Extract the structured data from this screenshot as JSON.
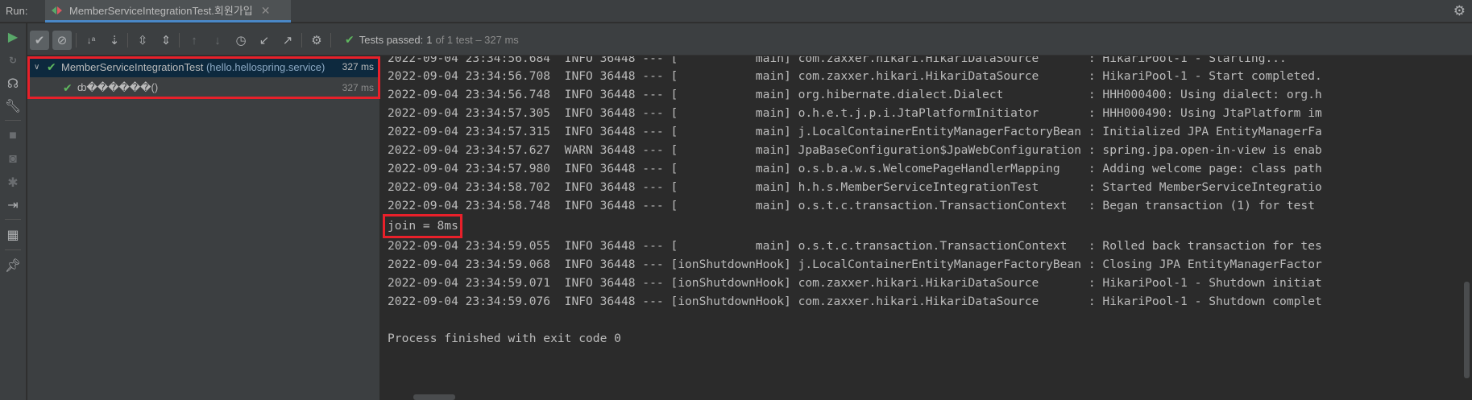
{
  "run": {
    "label": "Run:",
    "tab_title": "MemberServiceIntegrationTest.회원가입",
    "tab_close": "✕"
  },
  "status": {
    "label": "Tests passed:",
    "passed": "1",
    "rest": "of 1 test – 327 ms"
  },
  "tree": {
    "root": {
      "name": "MemberServiceIntegrationTest",
      "package": "(hello.hellospring.service)",
      "time": "327 ms"
    },
    "child": {
      "name": "ȸ������()",
      "time": "327 ms"
    }
  },
  "console": {
    "partial_line": "2022-09-04 23:34:56.684  INFO 36448 --- [           main] com.zaxxer.hikari.HikariDataSource       : HikariPool-1 - Starting...",
    "lines_before": [
      "2022-09-04 23:34:56.708  INFO 36448 --- [           main] com.zaxxer.hikari.HikariDataSource       : HikariPool-1 - Start completed.",
      "2022-09-04 23:34:56.748  INFO 36448 --- [           main] org.hibernate.dialect.Dialect            : HHH000400: Using dialect: org.h",
      "2022-09-04 23:34:57.305  INFO 36448 --- [           main] o.h.e.t.j.p.i.JtaPlatformInitiator       : HHH000490: Using JtaPlatform im",
      "2022-09-04 23:34:57.315  INFO 36448 --- [           main] j.LocalContainerEntityManagerFactoryBean : Initialized JPA EntityManagerFa",
      "2022-09-04 23:34:57.627  WARN 36448 --- [           main] JpaBaseConfiguration$JpaWebConfiguration : spring.jpa.open-in-view is enab",
      "2022-09-04 23:34:57.980  INFO 36448 --- [           main] o.s.b.a.w.s.WelcomePageHandlerMapping    : Adding welcome page: class path",
      "2022-09-04 23:34:58.702  INFO 36448 --- [           main] h.h.s.MemberServiceIntegrationTest       : Started MemberServiceIntegratio",
      "2022-09-04 23:34:58.748  INFO 36448 --- [           main] o.s.t.c.transaction.TransactionContext   : Began transaction (1) for test"
    ],
    "join_line": "join = 8ms",
    "lines_after": [
      "2022-09-04 23:34:59.055  INFO 36448 --- [           main] o.s.t.c.transaction.TransactionContext   : Rolled back transaction for tes",
      "2022-09-04 23:34:59.068  INFO 36448 --- [ionShutdownHook] j.LocalContainerEntityManagerFactoryBean : Closing JPA EntityManagerFactor",
      "2022-09-04 23:34:59.071  INFO 36448 --- [ionShutdownHook] com.zaxxer.hikari.HikariDataSource       : HikariPool-1 - Shutdown initiat",
      "2022-09-04 23:34:59.076  INFO 36448 --- [ionShutdownHook] com.zaxxer.hikari.HikariDataSource       : HikariPool-1 - Shutdown complet"
    ],
    "exit_line": "Process finished with exit code 0"
  },
  "icons": {
    "settings": "gear-icon",
    "rerun": "play-icon",
    "show_passed": "checkmark-icon",
    "show_ignored": "cancel-circle-icon",
    "sort_alpha": "sort-alphabetically-icon",
    "sort_duration": "sort-by-duration-icon",
    "expand_all": "expand-all-icon",
    "collapse_all": "collapse-all-icon",
    "prev_fail": "arrow-up-icon",
    "next_fail": "arrow-down-icon",
    "history": "clock-icon",
    "import": "import-icon",
    "export": "export-icon",
    "gear": "gear-icon"
  },
  "colors": {
    "pass": "#5fb85f",
    "highlight": "#e8202a",
    "selection": "#0d293e"
  }
}
